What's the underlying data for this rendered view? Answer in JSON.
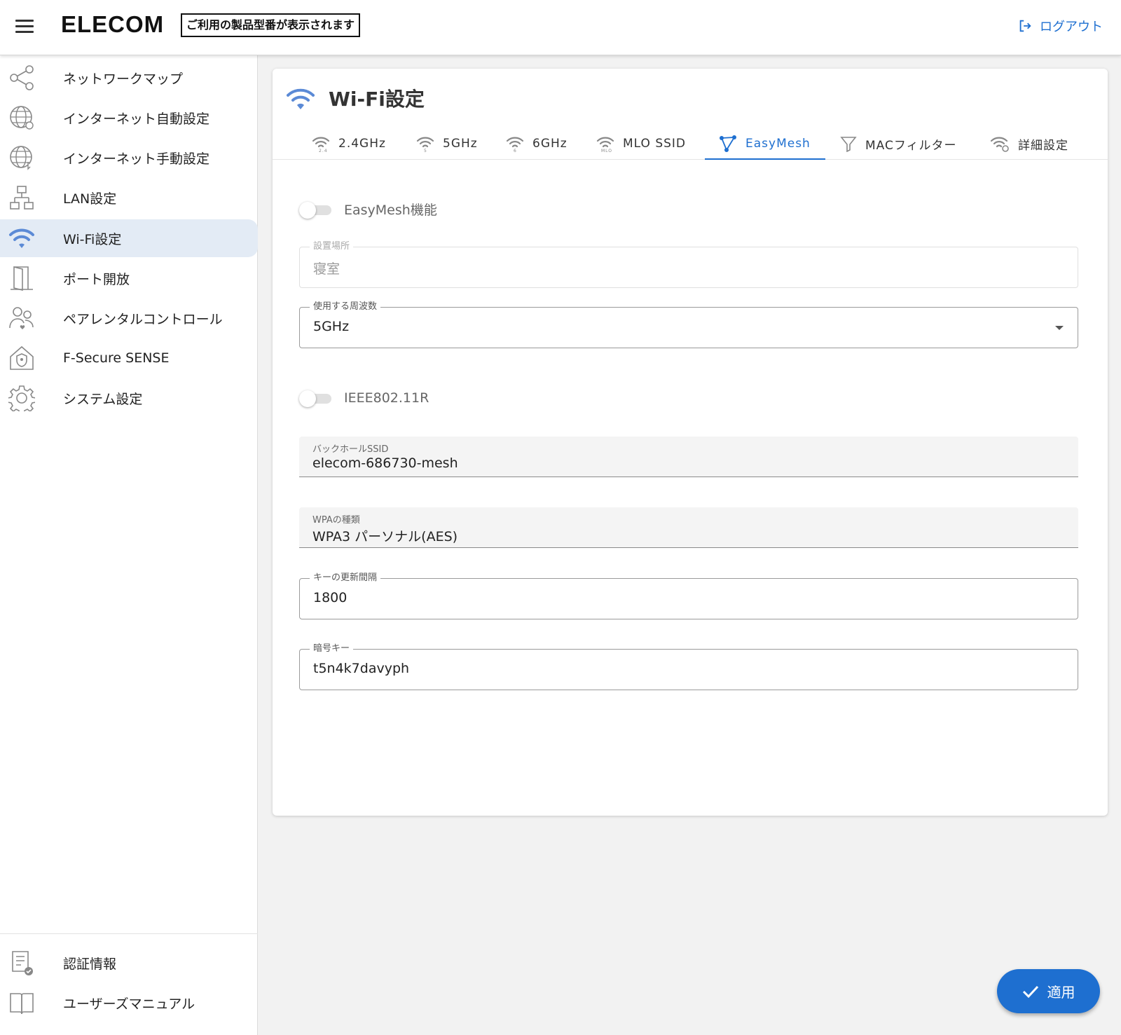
{
  "header": {
    "logo": "ELECOM",
    "model_text": "ご利用の製品型番が表示されます",
    "logout_label": "ログアウト"
  },
  "sidebar": {
    "items": [
      {
        "label": "ネットワークマップ",
        "icon": "share-icon"
      },
      {
        "label": "インターネット自動設定",
        "icon": "globe-auto-icon"
      },
      {
        "label": "インターネット手動設定",
        "icon": "globe-manual-icon"
      },
      {
        "label": "LAN設定",
        "icon": "lan-icon"
      },
      {
        "label": "Wi-Fi設定",
        "icon": "wifi-icon",
        "active": true
      },
      {
        "label": "ポート開放",
        "icon": "door-icon"
      },
      {
        "label": "ペアレンタルコントロール",
        "icon": "parental-icon"
      },
      {
        "label": "F-Secure SENSE",
        "icon": "home-shield-icon"
      },
      {
        "label": "システム設定",
        "icon": "gear-icon"
      }
    ],
    "bottom_items": [
      {
        "label": "認証情報",
        "icon": "certificate-icon"
      },
      {
        "label": "ユーザーズマニュアル",
        "icon": "book-icon"
      }
    ]
  },
  "main": {
    "title": "Wi-Fi設定",
    "tabs": [
      {
        "label": "2.4GHz",
        "icon": "wifi-24-icon"
      },
      {
        "label": "5GHz",
        "icon": "wifi-5-icon"
      },
      {
        "label": "6GHz",
        "icon": "wifi-6-icon"
      },
      {
        "label": "MLO SSID",
        "icon": "wifi-mlo-icon"
      },
      {
        "label": "EasyMesh",
        "icon": "mesh-icon",
        "active": true
      },
      {
        "label": "MACフィルター",
        "icon": "filter-icon"
      },
      {
        "label": "詳細設定",
        "icon": "wifi-settings-icon"
      }
    ],
    "easymesh_toggle": {
      "label": "EasyMesh機能",
      "checked": false
    },
    "location": {
      "label": "設置場所",
      "value": "寝室"
    },
    "frequency": {
      "label": "使用する周波数",
      "value": "5GHz"
    },
    "ieee_toggle": {
      "label": "IEEE802.11R",
      "checked": false
    },
    "backhaul_ssid": {
      "label": "バックホールSSID",
      "value": "elecom-686730-mesh"
    },
    "wpa_type": {
      "label": "WPAの種類",
      "value": "WPA3 パーソナル(AES)"
    },
    "key_interval": {
      "label": "キーの更新間隔",
      "value": "1800"
    },
    "encryption_key": {
      "label": "暗号キー",
      "value": "t5n4k7davyph"
    }
  },
  "apply_button": {
    "label": "適用"
  },
  "colors": {
    "accent": "#1e6fd0",
    "active_bg": "#e3ebf5",
    "wifi_icon": "#5b8ad6"
  }
}
